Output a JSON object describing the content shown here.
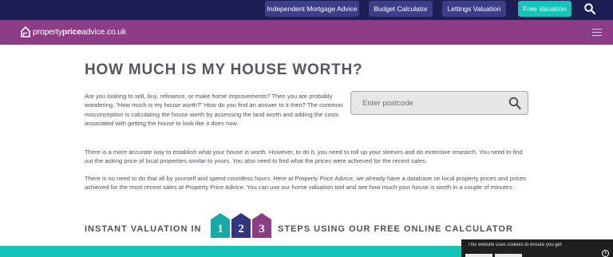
{
  "topbar": {
    "links": [
      "Independent Mortgage Advice",
      "Budget Calculator",
      "Lettings Valuation",
      "Free Valuation"
    ],
    "search_icon": "search-icon"
  },
  "nav": {
    "logo_prefix": "property",
    "logo_bold": "price",
    "logo_suffix": "advice.co.uk",
    "menu_icon": "hamburger-icon"
  },
  "page": {
    "title": "HOW MUCH IS MY HOUSE WORTH?",
    "paragraph1": "Are you looking to sell, buy, refinance, or make home improvements? Then you are probably wondering, “How much is my house worth?” How do you find an answer to it then? The common misconception is calculating the house worth by assessing the land worth and adding the costs associated with getting the house to look like it does now.",
    "paragraph2": "There is a more accurate way to establish what your house is worth. However, to do it, you need to roll up your sleeves and do extensive research. You need to find out the asking price of local properties similar to yours. You also need to find what the prices were achieved for the recent sales.",
    "paragraph3": "There is no need to do that all by yourself and spend countless hours. Here at Property Price Advice, we already have a database on local property prices and prices achieved for the most recent sales at Property Price Advice. You can use our home valuation tool and see how much your house is worth in a couple of minutes."
  },
  "postcode": {
    "placeholder": "Enter postcode",
    "value": ""
  },
  "steps": {
    "left_text": "INSTANT VALUATION IN",
    "right_text": "STEPS USING OUR FREE ONLINE CALCULATOR",
    "numbers": [
      "1",
      "2",
      "3"
    ]
  },
  "cookie": {
    "text": "This website uses cookies to ensure you get",
    "close": "x"
  },
  "colors": {
    "topbar": "#1d1f54",
    "nav": "#8f3c87",
    "accent": "#14c4b7",
    "house1": "#17a9a6",
    "house2": "#34357f",
    "house3": "#8f3c87"
  }
}
